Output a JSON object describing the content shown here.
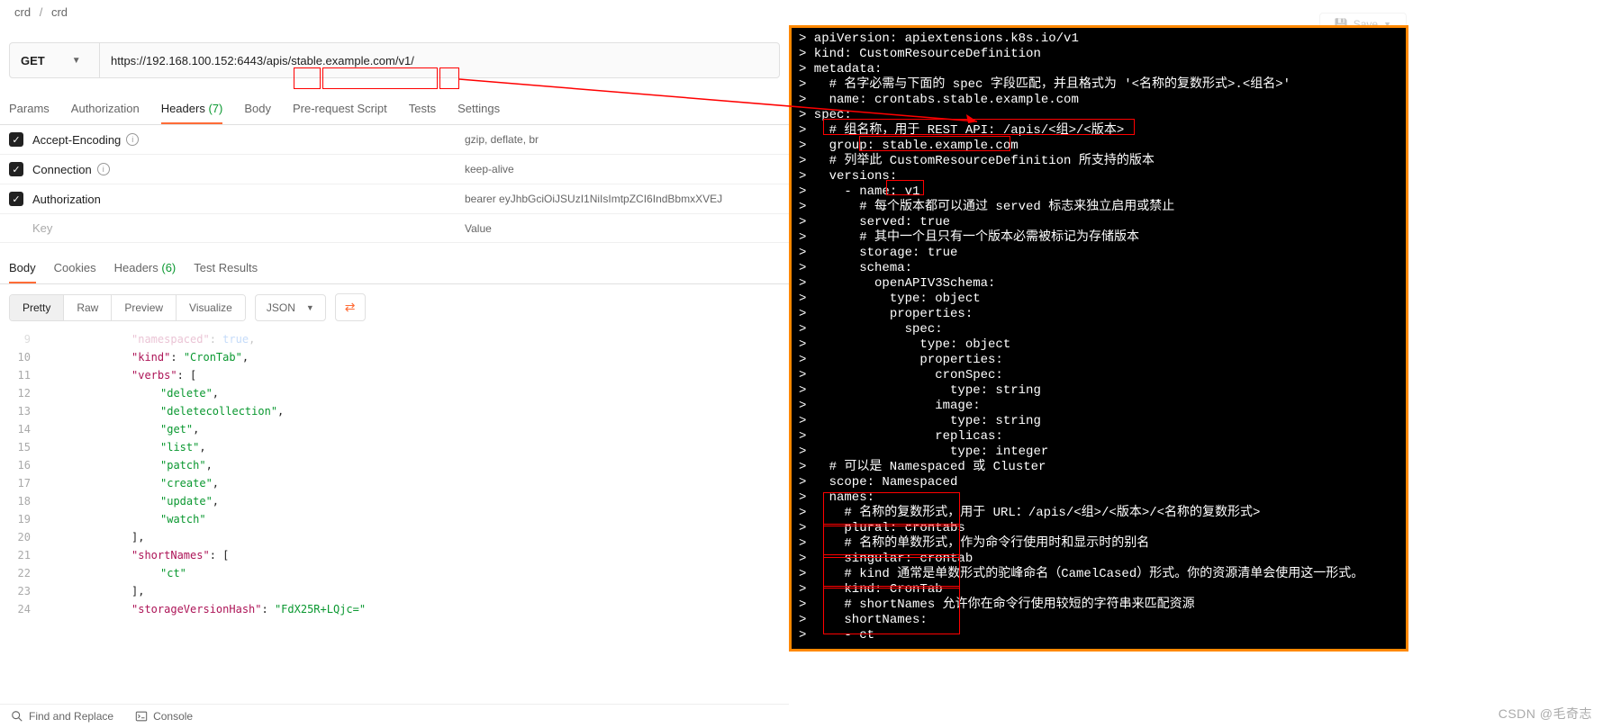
{
  "breadcrumb": {
    "seg1": "crd",
    "seg2": "crd",
    "sep": "/"
  },
  "request": {
    "method": "GET",
    "url_pre": "https://192.168.100.152:6443/",
    "url_apis": "apis",
    "url_mid": "/",
    "url_group": "stable.example.com",
    "url_mid2": "/",
    "url_ver": "v1/"
  },
  "top_buttons": {
    "save": "Save"
  },
  "tabs": {
    "params": "Params",
    "authorization": "Authorization",
    "headers": "Headers",
    "headers_count": "(7)",
    "body": "Body",
    "prerequest": "Pre-request Script",
    "tests": "Tests",
    "settings": "Settings"
  },
  "headers_rows": [
    {
      "key": "Accept-Encoding",
      "info": true,
      "value": "gzip, deflate, br"
    },
    {
      "key": "Connection",
      "info": true,
      "value": "keep-alive"
    },
    {
      "key": "Authorization",
      "info": false,
      "value": "bearer eyJhbGciOiJSUzI1NiIsImtpZCI6IndBbmxXVEJ"
    }
  ],
  "headers_placeholder": {
    "key": "Key",
    "value": "Value"
  },
  "response_tabs": {
    "body": "Body",
    "cookies": "Cookies",
    "headers": "Headers",
    "headers_count": "(6)",
    "results": "Test Results"
  },
  "view_controls": {
    "pretty": "Pretty",
    "raw": "Raw",
    "preview": "Preview",
    "visualize": "Visualize",
    "format": "JSON"
  },
  "json_lines": [
    {
      "n": "9",
      "indent": 12,
      "html": "<span class='json-key'>\"namespaced\"</span><span class='json-punc'>: </span><span class='json-bool'>true</span><span class='json-punc'>,</span>"
    },
    {
      "n": "10",
      "indent": 12,
      "html": "<span class='json-key'>\"kind\"</span><span class='json-punc'>: </span><span class='json-str'>\"CronTab\"</span><span class='json-punc'>,</span>"
    },
    {
      "n": "11",
      "indent": 12,
      "html": "<span class='json-key'>\"verbs\"</span><span class='json-punc'>: [</span>"
    },
    {
      "n": "12",
      "indent": 16,
      "html": "<span class='json-str'>\"delete\"</span><span class='json-punc'>,</span>"
    },
    {
      "n": "13",
      "indent": 16,
      "html": "<span class='json-str'>\"deletecollection\"</span><span class='json-punc'>,</span>"
    },
    {
      "n": "14",
      "indent": 16,
      "html": "<span class='json-str'>\"get\"</span><span class='json-punc'>,</span>"
    },
    {
      "n": "15",
      "indent": 16,
      "html": "<span class='json-str'>\"list\"</span><span class='json-punc'>,</span>"
    },
    {
      "n": "16",
      "indent": 16,
      "html": "<span class='json-str'>\"patch\"</span><span class='json-punc'>,</span>"
    },
    {
      "n": "17",
      "indent": 16,
      "html": "<span class='json-str'>\"create\"</span><span class='json-punc'>,</span>"
    },
    {
      "n": "18",
      "indent": 16,
      "html": "<span class='json-str'>\"update\"</span><span class='json-punc'>,</span>"
    },
    {
      "n": "19",
      "indent": 16,
      "html": "<span class='json-str'>\"watch\"</span>"
    },
    {
      "n": "20",
      "indent": 12,
      "html": "<span class='json-punc'>],</span>"
    },
    {
      "n": "21",
      "indent": 12,
      "html": "<span class='json-key'>\"shortNames\"</span><span class='json-punc'>: [</span>"
    },
    {
      "n": "22",
      "indent": 16,
      "html": "<span class='json-str'>\"ct\"</span>"
    },
    {
      "n": "23",
      "indent": 12,
      "html": "<span class='json-punc'>],</span>"
    },
    {
      "n": "24",
      "indent": 12,
      "html": "<span class='json-key'>\"storageVersionHash\"</span><span class='json-punc'>: </span><span class='json-str'>\"FdX25R+LQjc=\"</span>"
    }
  ],
  "bottom_bar": {
    "find": "Find and Replace",
    "console": "Console"
  },
  "terminal": [
    "apiVersion: apiextensions.k8s.io/v1",
    "kind: CustomResourceDefinition",
    "metadata:",
    "  # 名字必需与下面的 spec 字段匹配，并且格式为 '<名称的复数形式>.<组名>'",
    "  name: crontabs.stable.example.com",
    "spec:",
    "  # 组名称，用于 REST API: /apis/<组>/<版本>",
    "  group: stable.example.com",
    "  # 列举此 CustomResourceDefinition 所支持的版本",
    "  versions:",
    "    - name: v1",
    "      # 每个版本都可以通过 served 标志来独立启用或禁止",
    "      served: true",
    "      # 其中一个且只有一个版本必需被标记为存储版本",
    "      storage: true",
    "      schema:",
    "        openAPIV3Schema:",
    "          type: object",
    "          properties:",
    "            spec:",
    "              type: object",
    "              properties:",
    "                cronSpec:",
    "                  type: string",
    "                image:",
    "                  type: string",
    "                replicas:",
    "                  type: integer",
    "  # 可以是 Namespaced 或 Cluster",
    "  scope: Namespaced",
    "  names:",
    "    # 名称的复数形式，用于 URL：/apis/<组>/<版本>/<名称的复数形式>",
    "    plural: crontabs",
    "    # 名称的单数形式，作为命令行使用时和显示时的别名",
    "    singular: crontab",
    "    # kind 通常是单数形式的驼峰命名（CamelCased）形式。你的资源清单会使用这一形式。",
    "    kind: CronTab",
    "    # shortNames 允许你在命令行使用较短的字符串来匹配资源",
    "    shortNames:",
    "    - ct"
  ],
  "watermark": "CSDN @毛奇志"
}
